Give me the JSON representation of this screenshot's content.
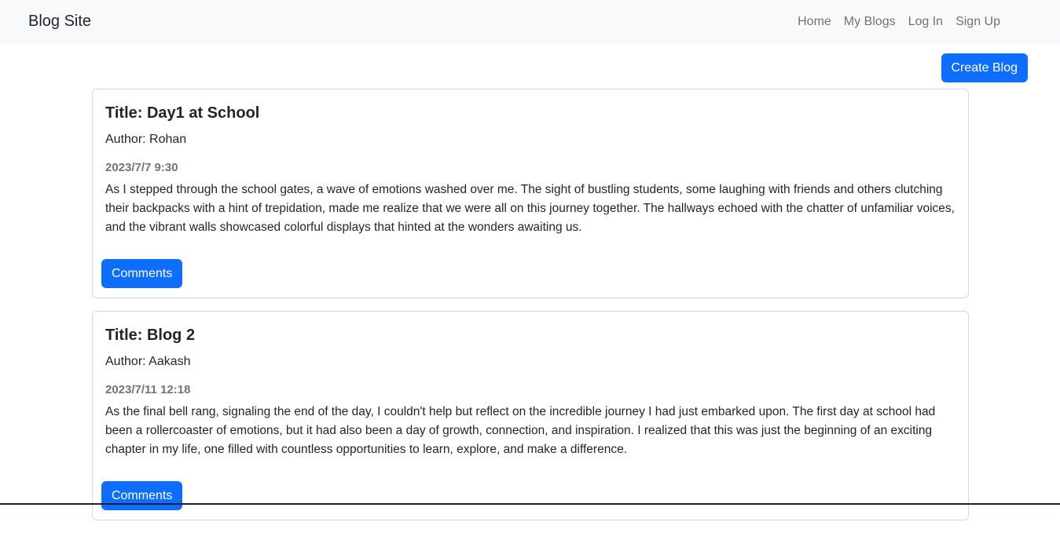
{
  "navbar": {
    "brand": "Blog Site",
    "links": [
      "Home",
      "My Blogs",
      "Log In",
      "Sign Up"
    ]
  },
  "create_label": "Create Blog",
  "blogs": [
    {
      "title": "Title: Day1 at School",
      "author": "Author: Rohan",
      "date": "2023/7/7 9:30",
      "content": "As I stepped through the school gates, a wave of emotions washed over me. The sight of bustling students, some laughing with friends and others clutching their backpacks with a hint of trepidation, made me realize that we were all on this journey together. The hallways echoed with the chatter of unfamiliar voices, and the vibrant walls showcased colorful displays that hinted at the wonders awaiting us.",
      "button": "Comments"
    },
    {
      "title": "Title: Blog 2",
      "author": "Author: Aakash",
      "date": "2023/7/11 12:18",
      "content": "As the final bell rang, signaling the end of the day, I couldn't help but reflect on the incredible journey I had just embarked upon. The first day at school had been a rollercoaster of emotions, but it had also been a day of growth, connection, and inspiration. I realized that this was just the beginning of an exciting chapter in my life, one filled with countless opportunities to learn, explore, and make a difference.",
      "button": "Comments"
    }
  ]
}
